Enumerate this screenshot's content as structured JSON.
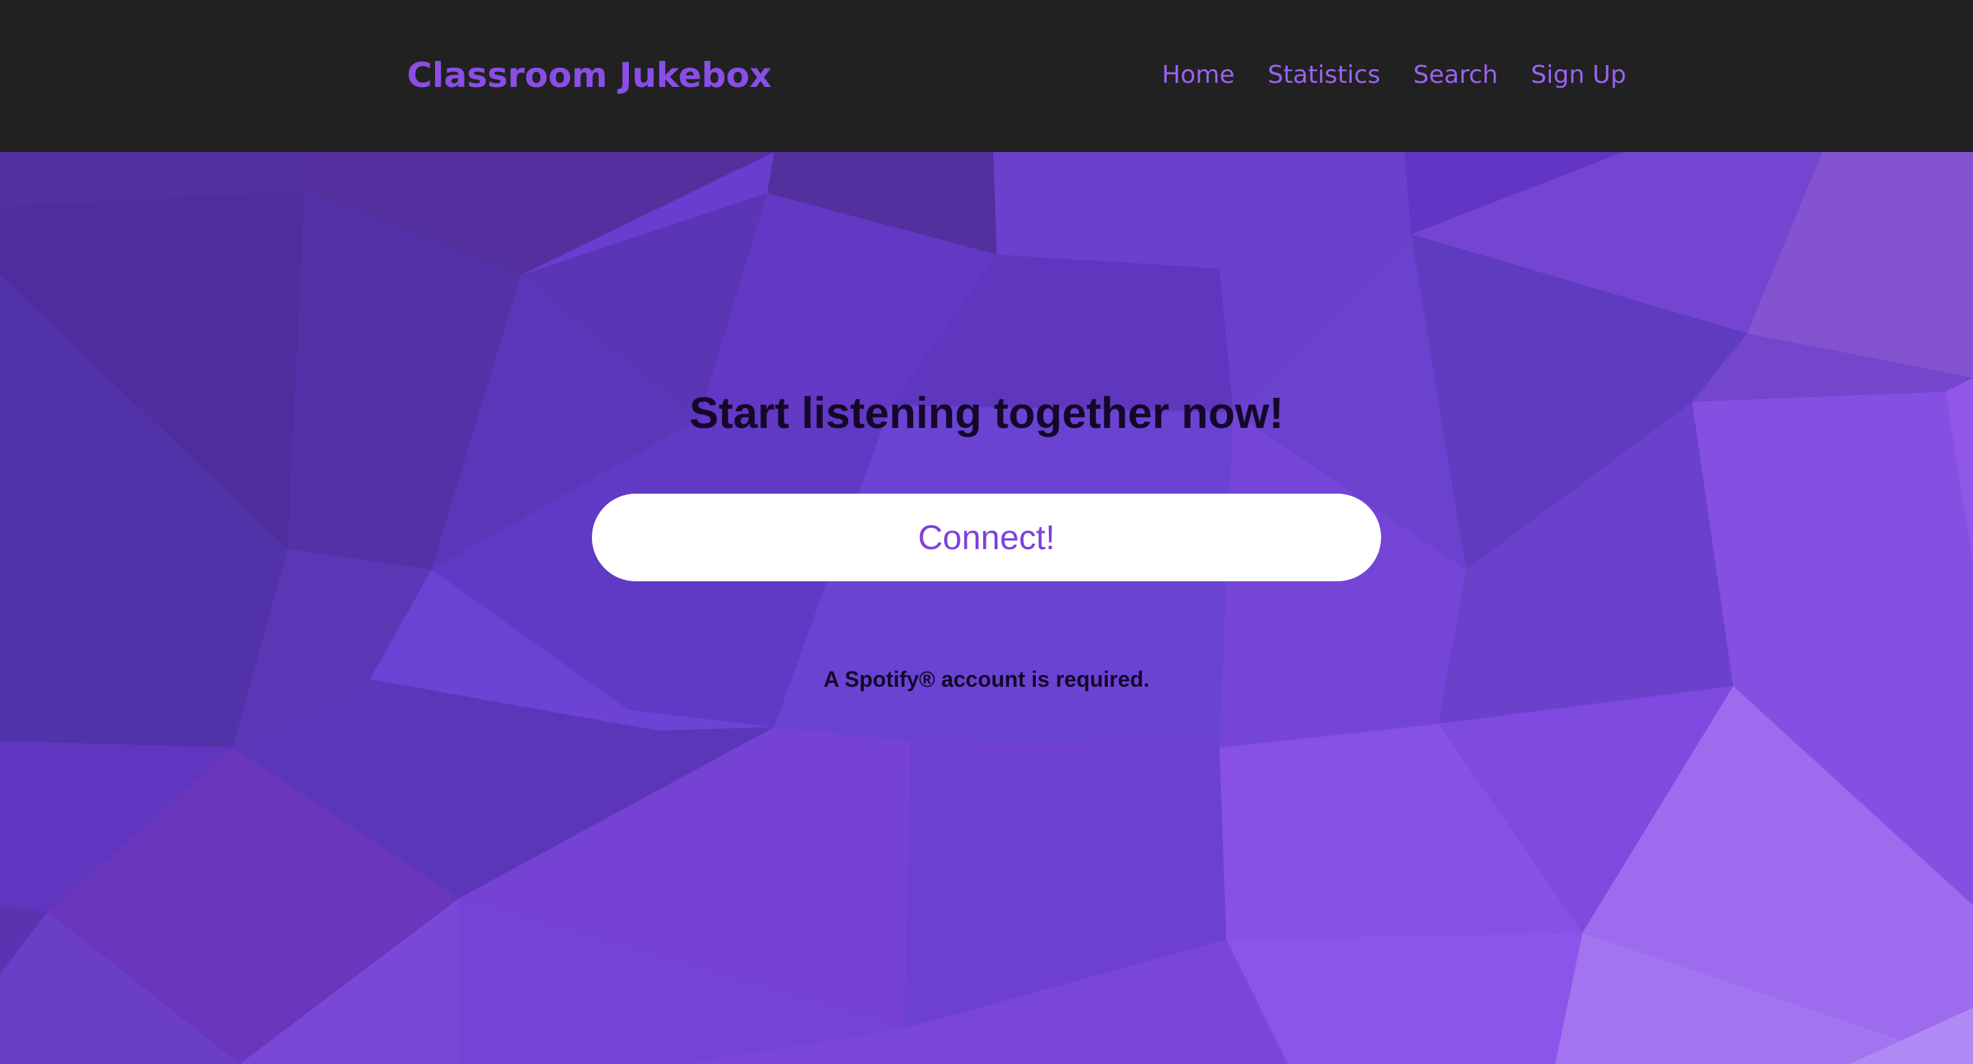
{
  "header": {
    "brand": "Classroom Jukebox",
    "nav": [
      {
        "label": "Home"
      },
      {
        "label": "Statistics"
      },
      {
        "label": "Search"
      },
      {
        "label": "Sign Up"
      }
    ]
  },
  "hero": {
    "headline": "Start listening together now!",
    "connect_label": "Connect!",
    "note": "A Spotify® account is required."
  },
  "colors": {
    "navbar_bg": "#212121",
    "brand": "#8a4ee6",
    "nav_link": "#9a63ef",
    "button_bg": "#ffffff",
    "button_text": "#7d42dc",
    "hero_base": "#6a3dd0"
  }
}
